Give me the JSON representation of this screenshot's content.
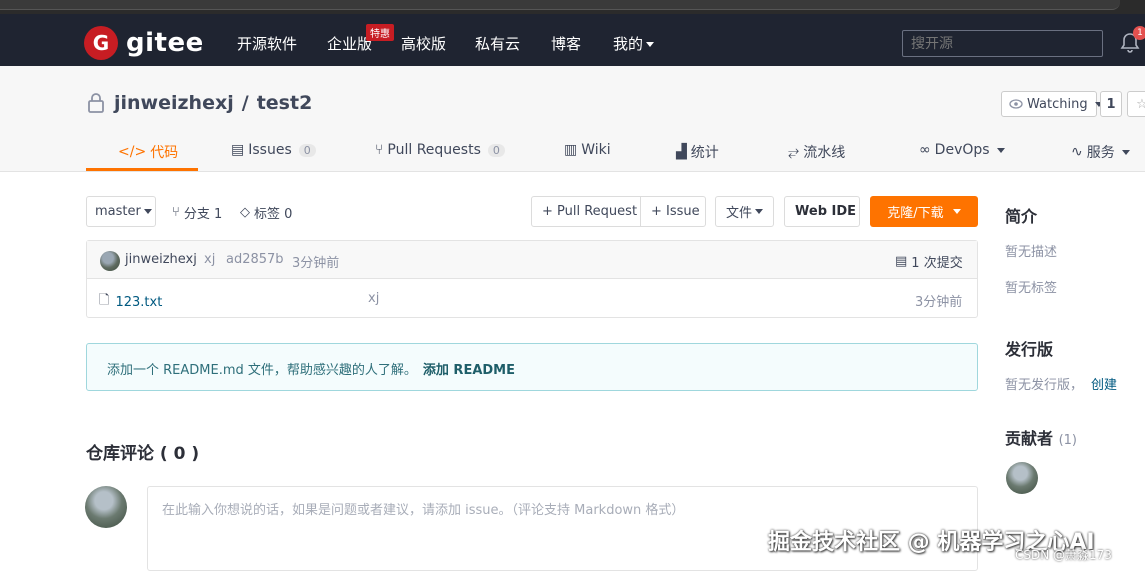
{
  "topnav": {
    "logo_text": "gitee",
    "logo_mark": "G",
    "items": [
      "开源软件",
      "企业版",
      "高校版",
      "私有云",
      "博客",
      "我的"
    ],
    "promo_badge": "特惠",
    "search_placeholder": "搜开源",
    "notification_count": "1"
  },
  "repo": {
    "owner": "jinweizhexj",
    "separator": "/",
    "name": "test2",
    "watch_label": "Watching",
    "watch_count": "1"
  },
  "tabs": [
    {
      "label": "代码",
      "icon": "code-icon"
    },
    {
      "label": "Issues",
      "count": "0",
      "icon": "issues-icon"
    },
    {
      "label": "Pull Requests",
      "count": "0",
      "icon": "pull-request-icon"
    },
    {
      "label": "Wiki",
      "icon": "wiki-icon"
    },
    {
      "label": "统计",
      "icon": "stats-icon"
    },
    {
      "label": "流水线",
      "icon": "pipeline-icon"
    },
    {
      "label": "DevOps",
      "icon": "devops-icon"
    },
    {
      "label": "服务",
      "icon": "service-icon"
    }
  ],
  "toolbar": {
    "branch": "master",
    "branches_label": "分支 1",
    "tags_label": "标签 0",
    "pull_request_btn": "+ Pull Request",
    "issue_btn": "+ Issue",
    "file_btn": "文件",
    "web_ide_btn": "Web IDE",
    "clone_btn": "克隆/下载"
  },
  "commit": {
    "author": "jinweizhexj",
    "message": "xj",
    "hash": "ad2857b",
    "time": "3分钟前",
    "commit_count": "1 次提交"
  },
  "files": [
    {
      "name": "123.txt",
      "message": "xj",
      "time": "3分钟前"
    }
  ],
  "readme_notice": {
    "text": "添加一个 README.md 文件，帮助感兴趣的人了解。",
    "link": "添加 README"
  },
  "comments": {
    "title": "仓库评论 ( 0 )",
    "placeholder": "在此输入你想说的话，如果是问题或者建议，请添加 issue。（评论支持 Markdown 格式）"
  },
  "sidebar": {
    "intro_title": "简介",
    "no_description": "暂无描述",
    "no_tags": "暂无标签",
    "release_title": "发行版",
    "no_release": "暂无发行版，",
    "create_link": "创建",
    "contributors_title": "贡献者",
    "contributors_count": "(1)"
  },
  "watermark": {
    "main": "掘金技术社区 @ 机器学习之心AI",
    "sub": "CSDN @萧淼173"
  },
  "colors": {
    "nav_bg": "#1f2431",
    "accent": "#fe7300",
    "brand_red": "#c71d23"
  }
}
